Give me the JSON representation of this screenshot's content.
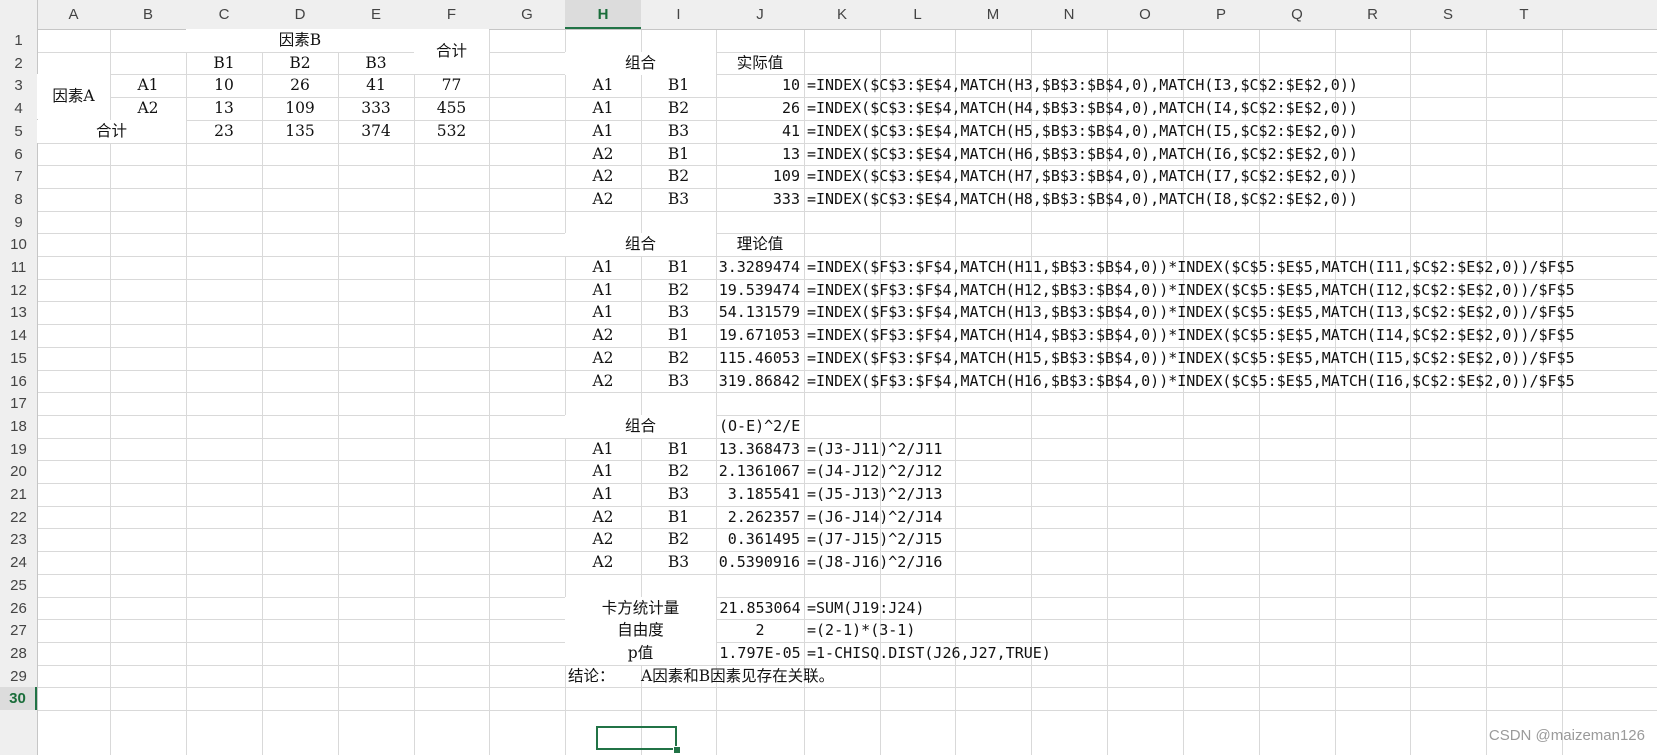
{
  "columns": [
    "A",
    "B",
    "C",
    "D",
    "E",
    "F",
    "G",
    "H",
    "I",
    "J",
    "K",
    "L",
    "M",
    "N",
    "O",
    "P",
    "Q",
    "R",
    "S",
    "T"
  ],
  "rows": [
    "1",
    "2",
    "3",
    "4",
    "5",
    "6",
    "7",
    "8",
    "9",
    "10",
    "11",
    "12",
    "13",
    "14",
    "15",
    "16",
    "17",
    "18",
    "19",
    "20",
    "21",
    "22",
    "23",
    "24",
    "25",
    "26",
    "27",
    "28",
    "29",
    "30"
  ],
  "selected_cell": {
    "col": "H",
    "row": "30"
  },
  "table1": {
    "factor_b_header": "因素B",
    "total_header": "合计",
    "b_levels": [
      "B1",
      "B2",
      "B3"
    ],
    "factor_a_label": "因素A",
    "a_levels": [
      "A1",
      "A2"
    ],
    "total_row_label": "合计",
    "rows": [
      {
        "values": [
          "10",
          "26",
          "41"
        ],
        "total": "77"
      },
      {
        "values": [
          "13",
          "109",
          "333"
        ],
        "total": "455"
      }
    ],
    "col_totals": [
      "23",
      "135",
      "374"
    ],
    "grand_total": "532"
  },
  "observed": {
    "group_header": "组合",
    "value_header": "实际值",
    "rows": [
      {
        "a": "A1",
        "b": "B1",
        "value": "10",
        "formula": "=INDEX($C$3:$E$4,MATCH(H3,$B$3:$B$4,0),MATCH(I3,$C$2:$E$2,0))"
      },
      {
        "a": "A1",
        "b": "B2",
        "value": "26",
        "formula": "=INDEX($C$3:$E$4,MATCH(H4,$B$3:$B$4,0),MATCH(I4,$C$2:$E$2,0))"
      },
      {
        "a": "A1",
        "b": "B3",
        "value": "41",
        "formula": "=INDEX($C$3:$E$4,MATCH(H5,$B$3:$B$4,0),MATCH(I5,$C$2:$E$2,0))"
      },
      {
        "a": "A2",
        "b": "B1",
        "value": "13",
        "formula": "=INDEX($C$3:$E$4,MATCH(H6,$B$3:$B$4,0),MATCH(I6,$C$2:$E$2,0))"
      },
      {
        "a": "A2",
        "b": "B2",
        "value": "109",
        "formula": "=INDEX($C$3:$E$4,MATCH(H7,$B$3:$B$4,0),MATCH(I7,$C$2:$E$2,0))"
      },
      {
        "a": "A2",
        "b": "B3",
        "value": "333",
        "formula": "=INDEX($C$3:$E$4,MATCH(H8,$B$3:$B$4,0),MATCH(I8,$C$2:$E$2,0))"
      }
    ]
  },
  "expected": {
    "group_header": "组合",
    "value_header": "理论值",
    "rows": [
      {
        "a": "A1",
        "b": "B1",
        "value": "3.3289474",
        "formula": "=INDEX($F$3:$F$4,MATCH(H11,$B$3:$B$4,0))*INDEX($C$5:$E$5,MATCH(I11,$C$2:$E$2,0))/$F$5"
      },
      {
        "a": "A1",
        "b": "B2",
        "value": "19.539474",
        "formula": "=INDEX($F$3:$F$4,MATCH(H12,$B$3:$B$4,0))*INDEX($C$5:$E$5,MATCH(I12,$C$2:$E$2,0))/$F$5"
      },
      {
        "a": "A1",
        "b": "B3",
        "value": "54.131579",
        "formula": "=INDEX($F$3:$F$4,MATCH(H13,$B$3:$B$4,0))*INDEX($C$5:$E$5,MATCH(I13,$C$2:$E$2,0))/$F$5"
      },
      {
        "a": "A2",
        "b": "B1",
        "value": "19.671053",
        "formula": "=INDEX($F$3:$F$4,MATCH(H14,$B$3:$B$4,0))*INDEX($C$5:$E$5,MATCH(I14,$C$2:$E$2,0))/$F$5"
      },
      {
        "a": "A2",
        "b": "B2",
        "value": "115.46053",
        "formula": "=INDEX($F$3:$F$4,MATCH(H15,$B$3:$B$4,0))*INDEX($C$5:$E$5,MATCH(I15,$C$2:$E$2,0))/$F$5"
      },
      {
        "a": "A2",
        "b": "B3",
        "value": "319.86842",
        "formula": "=INDEX($F$3:$F$4,MATCH(H16,$B$3:$B$4,0))*INDEX($C$5:$E$5,MATCH(I16,$C$2:$E$2,0))/$F$5"
      }
    ]
  },
  "chisq_terms": {
    "group_header": "组合",
    "value_header": "(O-E)^2/E",
    "rows": [
      {
        "a": "A1",
        "b": "B1",
        "value": "13.368473",
        "formula": "=(J3-J11)^2/J11"
      },
      {
        "a": "A1",
        "b": "B2",
        "value": "2.1361067",
        "formula": "=(J4-J12)^2/J12"
      },
      {
        "a": "A1",
        "b": "B3",
        "value": "3.185541",
        "formula": "=(J5-J13)^2/J13"
      },
      {
        "a": "A2",
        "b": "B1",
        "value": "2.262357",
        "formula": "=(J6-J14)^2/J14"
      },
      {
        "a": "A2",
        "b": "B2",
        "value": "0.361495",
        "formula": "=(J7-J15)^2/J15"
      },
      {
        "a": "A2",
        "b": "B3",
        "value": "0.5390916",
        "formula": "=(J8-J16)^2/J16"
      }
    ]
  },
  "summary": [
    {
      "label": "卡方统计量",
      "value": "21.853064",
      "formula": "=SUM(J19:J24)"
    },
    {
      "label": "自由度",
      "value": "2",
      "formula": "=(2-1)*(3-1)"
    },
    {
      "label": "p值",
      "value": "1.797E-05",
      "formula": "=1-CHISQ.DIST(J26,J27,TRUE)"
    }
  ],
  "conclusion": {
    "label": "结论：",
    "text": "A因素和B因素见存在关联。"
  },
  "watermark": "CSDN @maizeman126"
}
